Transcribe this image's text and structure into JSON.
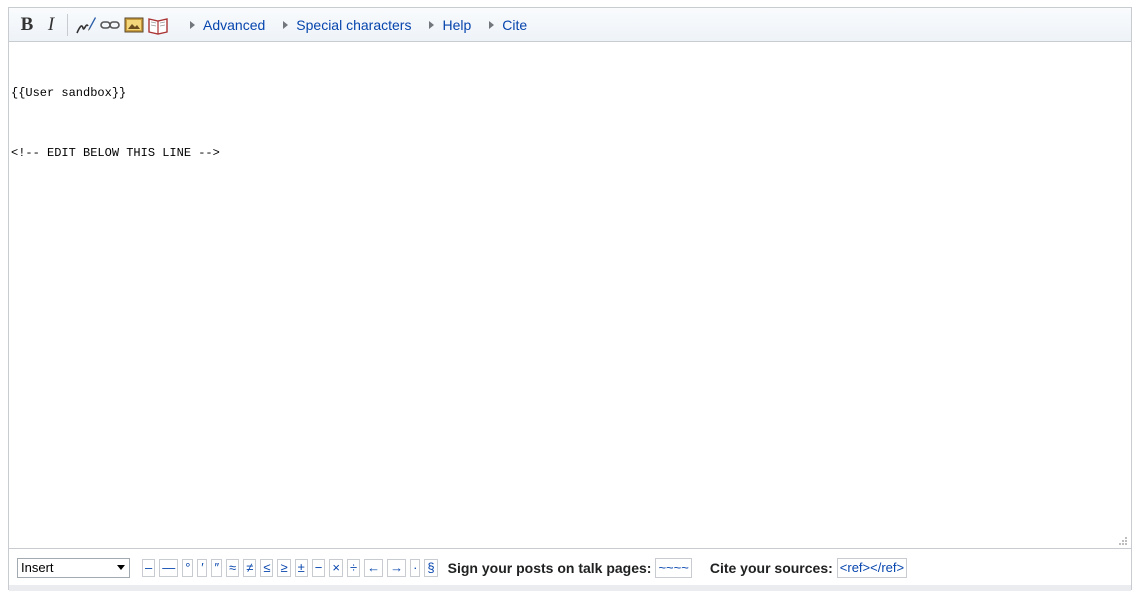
{
  "toolbar": {
    "bold_label": "B",
    "italic_label": "I",
    "tools": [
      {
        "name": "signature-icon"
      },
      {
        "name": "link-icon"
      },
      {
        "name": "image-icon"
      },
      {
        "name": "reference-icon"
      }
    ],
    "tabs": [
      {
        "label": "Advanced"
      },
      {
        "label": "Special characters"
      },
      {
        "label": "Help"
      },
      {
        "label": "Cite"
      }
    ]
  },
  "editor": {
    "lines": [
      "{{User sandbox}}",
      "<!-- EDIT BELOW THIS LINE -->"
    ]
  },
  "bottom": {
    "select_value": "Insert",
    "chars": [
      "–",
      "—",
      "°",
      "′",
      "″",
      "≈",
      "≠",
      "≤",
      "≥",
      "±",
      "−",
      "×",
      "÷",
      "←",
      "→",
      "·",
      "§"
    ],
    "sign_label": "Sign your posts on talk pages:",
    "sign_snippet": "~~~~",
    "cite_label": "Cite your sources:",
    "cite_snippet": "<ref></ref>"
  },
  "colors": {
    "link": "#0645ad",
    "border": "#c8ccd1",
    "toolbar_bg": "#eef3f8"
  }
}
